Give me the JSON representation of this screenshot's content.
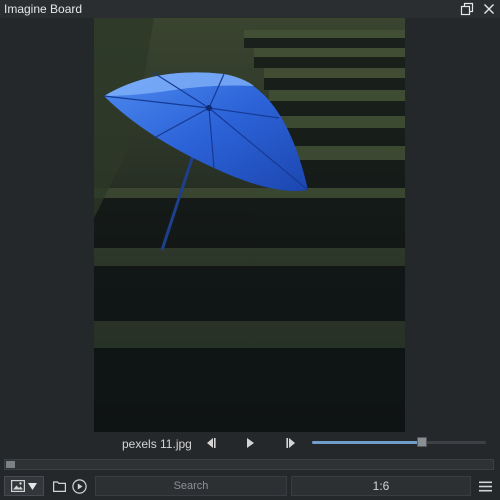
{
  "window": {
    "title": "Imagine Board",
    "restore_icon": "restore-window-icon",
    "close_icon": "close-icon"
  },
  "viewer": {
    "image_alt": "Blue umbrella on mossy stone steps"
  },
  "navbar": {
    "filename": "pexels 11.jpg",
    "prev_icon": "skip-previous-icon",
    "play_icon": "play-icon",
    "next_icon": "skip-next-icon",
    "position_fraction": 0.63
  },
  "toolbar": {
    "view_mode_icon": "image-icon",
    "dropdown_icon": "triangle-down-icon",
    "open_folder_icon": "folder-icon",
    "slideshow_icon": "play-circle-icon",
    "search_placeholder": "Search",
    "ratio": "1:6",
    "menu_icon": "hamburger-menu-icon"
  },
  "colors": {
    "accent": "#6f9ec9",
    "background": "#25282b",
    "umbrella_blue": "#2f6fe0"
  }
}
